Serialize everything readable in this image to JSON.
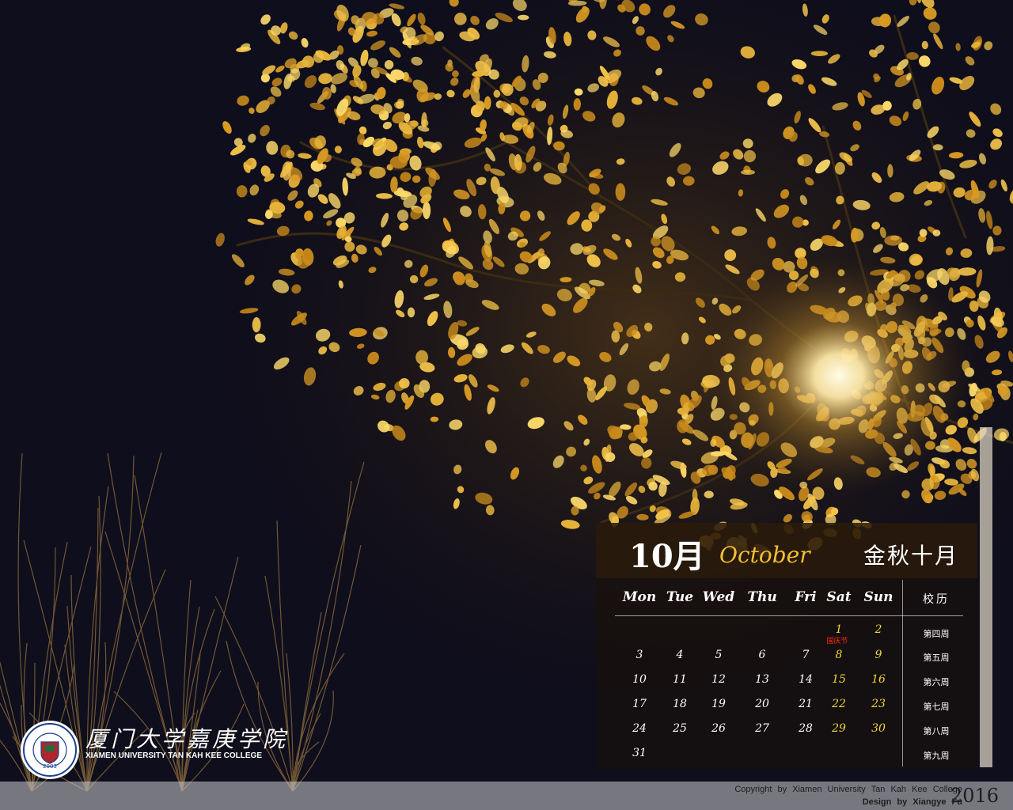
{
  "calendar": {
    "month_num": "10月",
    "month_en": "October",
    "month_cn": "金秋十月",
    "weekdays": [
      "Mon",
      "Tue",
      "Wed",
      "Thu",
      "Fri",
      "Sat",
      "Sun"
    ],
    "jiaoli_label": "校历",
    "holiday_note": "国庆节",
    "weeks": [
      {
        "label": "第四周",
        "days": [
          "",
          "",
          "",
          "",
          "",
          "1",
          "2"
        ]
      },
      {
        "label": "第五周",
        "days": [
          "3",
          "4",
          "5",
          "6",
          "7",
          "8",
          "9"
        ]
      },
      {
        "label": "第六周",
        "days": [
          "10",
          "11",
          "12",
          "13",
          "14",
          "15",
          "16"
        ]
      },
      {
        "label": "第七周",
        "days": [
          "17",
          "18",
          "19",
          "20",
          "21",
          "22",
          "23"
        ]
      },
      {
        "label": "第八周",
        "days": [
          "24",
          "25",
          "26",
          "27",
          "28",
          "29",
          "30"
        ]
      },
      {
        "label": "第九周",
        "days": [
          "31",
          "",
          "",
          "",
          "",
          "",
          ""
        ]
      }
    ]
  },
  "logo": {
    "name_cn": "厦门大学嘉庚学院",
    "name_en": "XIAMEN UNIVERSITY TAN KAH KEE COLLEGE",
    "seal_year": "2003"
  },
  "footer": {
    "copyright": "Copyright by Xiamen University Tan Kah Kee College",
    "design": "Design by Xiangye Fu",
    "year": "2016"
  },
  "colors": {
    "sky": "#0f0e1c",
    "leaf": "#e8b43a",
    "lamp": "#fff6d0",
    "weekend": "#f2d53a",
    "holiday": "#ff2a1a"
  }
}
